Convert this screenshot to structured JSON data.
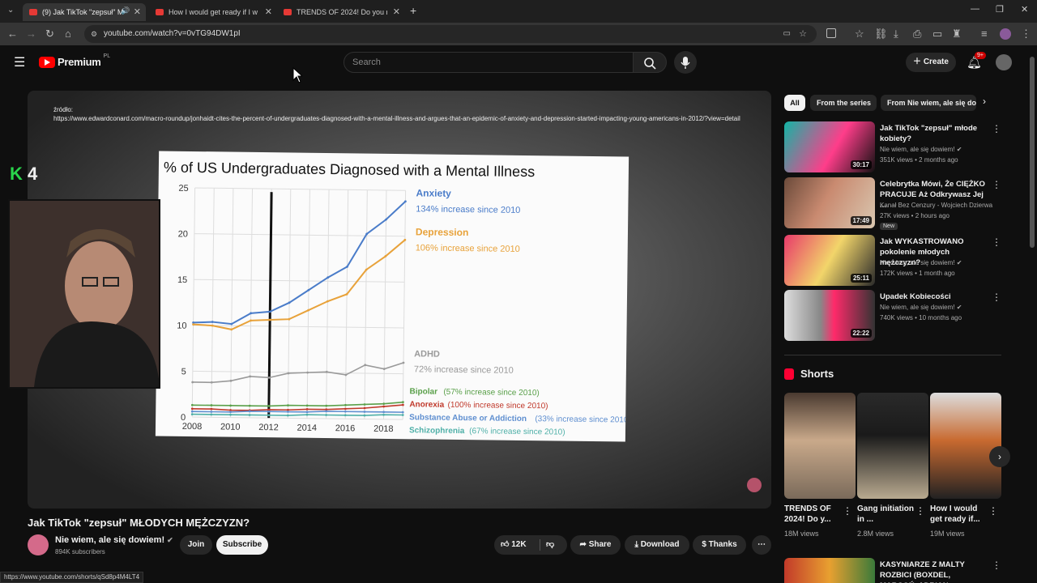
{
  "browser": {
    "tabs": [
      {
        "label": "(9) Jak TikTok \"zepsuł\" MŁODYCH",
        "active": true
      },
      {
        "label": "How I would get ready if I was",
        "active": false
      },
      {
        "label": "TRENDS OF 2024! Do you recog",
        "active": false
      }
    ],
    "url": "youtube.com/watch?v=0vTG94DW1pI"
  },
  "header": {
    "brand": "Premium",
    "region": "PL",
    "search_placeholder": "Search",
    "create_label": "Create",
    "notif_badge": "9+"
  },
  "video": {
    "source_text": "źródło:\nhttps://www.edwardconard.com/macro-roundup/jonhaidt-cites-the-percent-of-undergraduates-diagnosed-with-a-mental-illness-and-argues-that-an-epidemic-of-anxiety-and-depression-started-impacting-young-americans-in-2012/?view=detail",
    "logo_text": "4",
    "title": "Jak TikTok \"zepsuł\" MŁODYCH MĘŻCZYZN?"
  },
  "chart_data": {
    "type": "line",
    "title": "% of US Undergraduates Diagnosed with a Mental Illness",
    "xlabel": "",
    "ylabel": "",
    "x": [
      2008,
      2009,
      2010,
      2011,
      2012,
      2013,
      2014,
      2015,
      2016,
      2017,
      2018,
      2019
    ],
    "x_ticks": [
      "2008",
      "2010",
      "2012",
      "2014",
      "2016",
      "2018"
    ],
    "y_ticks": [
      "0",
      "5",
      "10",
      "15",
      "20",
      "25"
    ],
    "ylim": [
      0,
      25
    ],
    "xlim": [
      2008,
      2019
    ],
    "marker_line": 2012,
    "grid": true,
    "series": [
      {
        "name": "Anxiety",
        "note": "134% increase since 2010",
        "color": "#4a7cc9",
        "values": [
          10.3,
          10.4,
          10.2,
          11.4,
          11.6,
          12.6,
          14.0,
          15.4,
          16.6,
          20.2,
          21.8,
          23.8
        ]
      },
      {
        "name": "Depression",
        "note": "106% increase since 2010",
        "color": "#e8a23a",
        "values": [
          10.1,
          10.0,
          9.6,
          10.6,
          10.7,
          10.8,
          11.8,
          12.8,
          13.6,
          16.3,
          17.8,
          19.6
        ]
      },
      {
        "name": "ADHD",
        "note": "72% increase since 2010",
        "color": "#9a9a9a",
        "values": [
          3.8,
          3.8,
          4.0,
          4.5,
          4.4,
          4.9,
          5.0,
          5.1,
          4.8,
          5.9,
          5.5,
          6.2
        ]
      },
      {
        "name": "Bipolar",
        "note": "(57% increase since 2010)",
        "color": "#5aa04a",
        "values": [
          1.3,
          1.3,
          1.3,
          1.3,
          1.3,
          1.4,
          1.4,
          1.4,
          1.5,
          1.6,
          1.7,
          1.9
        ]
      },
      {
        "name": "Anorexia",
        "note": "(100% increase since 2010)",
        "color": "#c0392b",
        "values": [
          0.9,
          0.9,
          0.8,
          0.8,
          0.9,
          0.9,
          1.0,
          1.0,
          1.1,
          1.2,
          1.4,
          1.6
        ]
      },
      {
        "name": "Substance Abuse or Addiction",
        "note": "(33% increase since 2010)",
        "color": "#5f8fd0",
        "values": [
          0.6,
          0.6,
          0.6,
          0.7,
          0.7,
          0.7,
          0.7,
          0.8,
          0.8,
          0.8,
          0.8,
          0.8
        ]
      },
      {
        "name": "Schizophrenia",
        "note": "(67% increase since 2010)",
        "color": "#4fb0a8",
        "values": [
          0.3,
          0.3,
          0.3,
          0.3,
          0.3,
          0.3,
          0.4,
          0.4,
          0.4,
          0.4,
          0.5,
          0.5
        ]
      }
    ]
  },
  "channel": {
    "name": "Nie wiem, ale się dowiem!",
    "subscribers": "894K subscribers",
    "join_label": "Join",
    "subscribe_label": "Subscribe"
  },
  "actions": {
    "likes": "12K",
    "share_label": "Share",
    "download_label": "Download",
    "thanks_label": "Thanks"
  },
  "sidebar": {
    "chips": [
      "All",
      "From the series",
      "From Nie wiem, ale się do"
    ],
    "recommendations": [
      {
        "title": "Jak TikTok \"zepsuł\" młode kobiety?",
        "channel": "Nie wiem, ale się dowiem!",
        "meta": "351K views • 2 months ago",
        "duration": "30:17",
        "badge": ""
      },
      {
        "title": "Celebrytka Mówi, Że CIĘŻKO PRACUJE Aż Odkrywasz Jej ...",
        "channel": "Kanał Bez Cenzury - Wojciech Dzierwa",
        "meta": "27K views • 2 hours ago",
        "duration": "17:49",
        "badge": "New"
      },
      {
        "title": "Jak WYKASTROWANO pokolenie młodych mężczyzn?",
        "channel": "Nie wiem, ale się dowiem!",
        "meta": "172K views • 1 month ago",
        "duration": "25:11",
        "badge": ""
      },
      {
        "title": "Upadek Kobiecości",
        "channel": "Nie wiem, ale się dowiem!",
        "meta": "740K views • 10 months ago",
        "duration": "22:22",
        "badge": ""
      }
    ],
    "shorts_heading": "Shorts",
    "shorts": [
      {
        "title": "TRENDS OF 2024! Do y...",
        "views": "18M views"
      },
      {
        "title": "Gang initiation in ...",
        "views": "2.8M views"
      },
      {
        "title": "How I would get ready if...",
        "views": "19M views"
      }
    ],
    "last_rec_title": "KASYNIARZE Z MALTY ROZBICI (BOXDEL, MARCOŃ, ADRIAN ..."
  },
  "status_url": "https://www.youtube.com/shorts/qSd8p4M4LT4"
}
